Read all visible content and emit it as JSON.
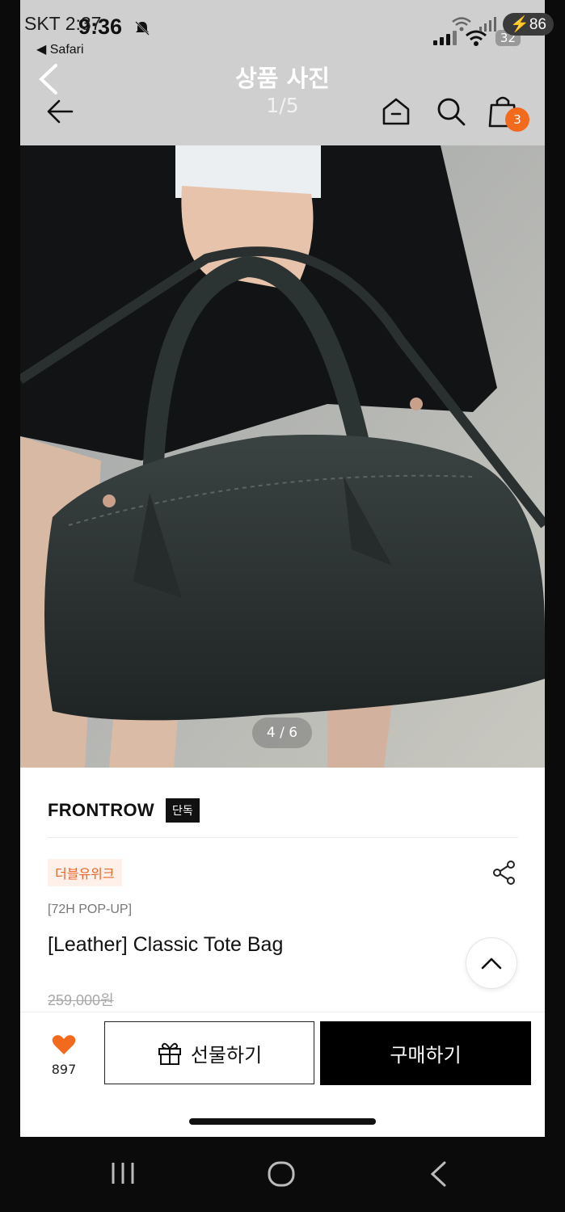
{
  "android_status": {
    "carrier": "SKT 2:37",
    "battery": "86",
    "icons": [
      "wifi-icon",
      "signal-icon",
      "charging-icon"
    ]
  },
  "ios_status": {
    "time": "9:36",
    "back_app": "◀ Safari",
    "battery": "32",
    "icons": [
      "bell-mute-icon",
      "signal-bars-icon",
      "wifi-icon"
    ]
  },
  "viewer": {
    "title": "상품 사진",
    "counter": "1/5"
  },
  "app_header": {
    "cart_count": "3",
    "icons": [
      "back-arrow-icon",
      "home-icon",
      "search-icon",
      "shopping-bag-icon"
    ]
  },
  "photo": {
    "counter": "4 / 6"
  },
  "product": {
    "brand": "FRONTROW",
    "exclusive_badge": "단독",
    "tag": "더블유위크",
    "subtitle": "[72H POP-UP]",
    "title": "[Leather] Classic Tote Bag",
    "original_price": "259,000원"
  },
  "bottom_bar": {
    "like_count": "897",
    "gift_label": "선물하기",
    "buy_label": "구매하기"
  },
  "colors": {
    "accent": "#f26b1d",
    "tag_bg": "#fff1ea",
    "tag_text": "#e8662a",
    "buy_bg": "#000000"
  }
}
